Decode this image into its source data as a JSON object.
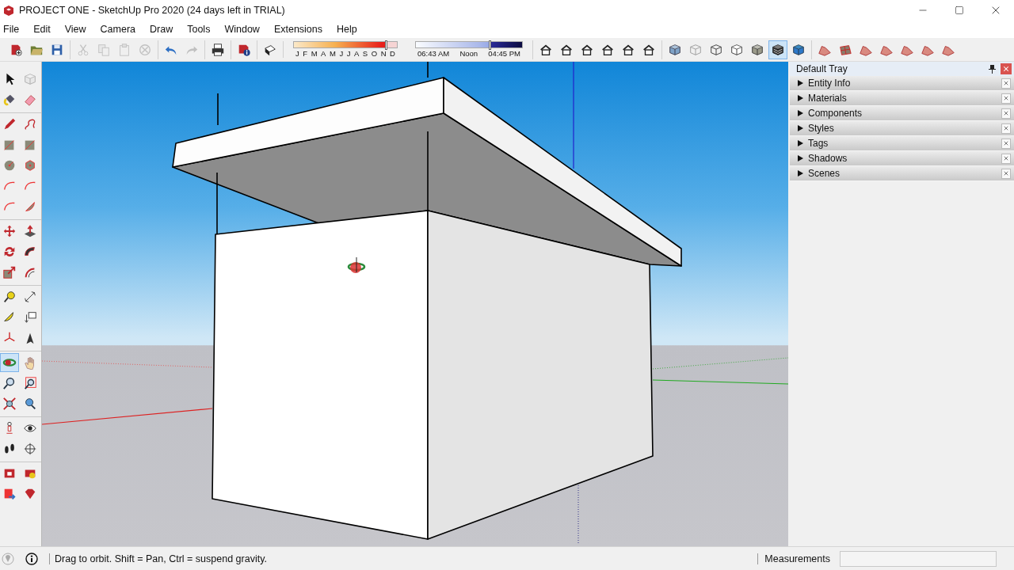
{
  "window": {
    "title": "PROJECT ONE - SketchUp Pro 2020 (24 days left in TRIAL)"
  },
  "menu": [
    "File",
    "Edit",
    "View",
    "Camera",
    "Draw",
    "Tools",
    "Window",
    "Extensions",
    "Help"
  ],
  "toolbar": [
    {
      "kind": "buttons",
      "items": [
        {
          "kind": "new",
          "disabled": false,
          "selected": false
        },
        {
          "kind": "open",
          "disabled": false,
          "selected": false
        },
        {
          "kind": "save",
          "disabled": false,
          "selected": false
        }
      ]
    },
    {
      "kind": "buttons",
      "items": [
        {
          "kind": "cut",
          "disabled": true,
          "selected": false
        },
        {
          "kind": "copy",
          "disabled": true,
          "selected": false
        },
        {
          "kind": "paste",
          "disabled": true,
          "selected": false
        },
        {
          "kind": "erase",
          "disabled": true,
          "selected": false
        }
      ]
    },
    {
      "kind": "buttons",
      "items": [
        {
          "kind": "undo",
          "disabled": false,
          "selected": false
        },
        {
          "kind": "redo",
          "disabled": true,
          "selected": false
        }
      ]
    },
    {
      "kind": "buttons",
      "items": [
        {
          "kind": "print",
          "disabled": false,
          "selected": false
        }
      ]
    },
    {
      "kind": "buttons",
      "items": [
        {
          "kind": "info",
          "disabled": false,
          "selected": false
        }
      ]
    },
    {
      "kind": "buttons",
      "items": [
        {
          "kind": "shadow",
          "disabled": false,
          "selected": false
        }
      ]
    },
    {
      "kind": "shadows",
      "months": [
        "J",
        "F",
        "M",
        "A",
        "M",
        "J",
        "J",
        "A",
        "S",
        "O",
        "N",
        "D"
      ],
      "date_slider": {
        "level": 0.9
      },
      "times": [
        "06:43 AM",
        "Noon",
        "04:45 PM"
      ],
      "time_slider": {
        "level": 0.7
      }
    },
    {
      "kind": "buttons",
      "items": [
        {
          "kind": "view",
          "disabled": false,
          "selected": false
        },
        {
          "kind": "view",
          "disabled": false,
          "selected": false
        },
        {
          "kind": "view",
          "disabled": false,
          "selected": false
        },
        {
          "kind": "view",
          "disabled": false,
          "selected": false
        },
        {
          "kind": "view",
          "disabled": false,
          "selected": false
        },
        {
          "kind": "view",
          "disabled": false,
          "selected": false
        }
      ]
    },
    {
      "kind": "buttons",
      "items": [
        {
          "kind": "xray",
          "disabled": false,
          "selected": false
        },
        {
          "kind": "backedges",
          "disabled": false,
          "selected": false
        },
        {
          "kind": "wireframe",
          "disabled": false,
          "selected": false
        },
        {
          "kind": "hidden",
          "disabled": false,
          "selected": false
        },
        {
          "kind": "shaded",
          "disabled": false,
          "selected": false
        },
        {
          "kind": "textured",
          "disabled": false,
          "selected": true
        },
        {
          "kind": "mono",
          "disabled": false,
          "selected": false
        }
      ]
    },
    {
      "kind": "buttons",
      "items": [
        {
          "kind": "terrain",
          "disabled": false,
          "selected": false
        },
        {
          "kind": "mesh",
          "disabled": false,
          "selected": false
        },
        {
          "kind": "terrain",
          "disabled": false,
          "selected": false
        },
        {
          "kind": "terrain",
          "disabled": false,
          "selected": false
        },
        {
          "kind": "terrain",
          "disabled": false,
          "selected": false
        },
        {
          "kind": "terrain",
          "disabled": false,
          "selected": false
        },
        {
          "kind": "terrain",
          "disabled": false,
          "selected": false
        }
      ]
    }
  ],
  "left_toolbar": [
    [
      {
        "kind": "select",
        "selected": false
      },
      {
        "kind": "component",
        "selected": false
      },
      {
        "kind": "paint",
        "selected": false
      },
      {
        "kind": "eraser",
        "selected": false
      }
    ],
    [
      {
        "kind": "pencil",
        "selected": false
      },
      {
        "kind": "freehand",
        "selected": false
      },
      {
        "kind": "rect",
        "selected": false
      },
      {
        "kind": "rect",
        "selected": false
      },
      {
        "kind": "circle",
        "selected": false
      },
      {
        "kind": "polygon",
        "selected": false
      },
      {
        "kind": "arc",
        "selected": false
      },
      {
        "kind": "arc",
        "selected": false
      },
      {
        "kind": "arc",
        "selected": false
      },
      {
        "kind": "pie",
        "selected": false
      }
    ],
    [
      {
        "kind": "move",
        "selected": false
      },
      {
        "kind": "pushpull",
        "selected": false
      },
      {
        "kind": "rotate",
        "selected": false
      },
      {
        "kind": "follow",
        "selected": false
      },
      {
        "kind": "scale",
        "selected": false
      },
      {
        "kind": "offset",
        "selected": false
      }
    ],
    [
      {
        "kind": "tape",
        "selected": false
      },
      {
        "kind": "dimension",
        "selected": false
      },
      {
        "kind": "protractor",
        "selected": false
      },
      {
        "kind": "textlabel",
        "selected": false
      },
      {
        "kind": "axes",
        "selected": false
      },
      {
        "kind": "text3d",
        "selected": false
      }
    ],
    [
      {
        "kind": "orbit",
        "selected": true
      },
      {
        "kind": "pan",
        "selected": false
      },
      {
        "kind": "zoom",
        "selected": false
      },
      {
        "kind": "zoomwin",
        "selected": false
      },
      {
        "kind": "extents",
        "selected": false
      },
      {
        "kind": "previous",
        "selected": false
      }
    ],
    [
      {
        "kind": "position",
        "selected": false
      },
      {
        "kind": "look",
        "selected": false
      },
      {
        "kind": "walk",
        "selected": false
      },
      {
        "kind": "section",
        "selected": false
      }
    ],
    [
      {
        "kind": "warehouse",
        "selected": false
      },
      {
        "kind": "extension",
        "selected": false
      },
      {
        "kind": "share",
        "selected": false
      },
      {
        "kind": "ruby",
        "selected": false
      }
    ]
  ],
  "tray": {
    "title": "Default Tray",
    "panels": [
      {
        "label": "Entity Info",
        "expanded": false
      },
      {
        "label": "Materials",
        "expanded": false
      },
      {
        "label": "Components",
        "expanded": false
      },
      {
        "label": "Styles",
        "expanded": false
      },
      {
        "label": "Tags",
        "expanded": false
      },
      {
        "label": "Shadows",
        "expanded": false
      },
      {
        "label": "Scenes",
        "expanded": false
      }
    ]
  },
  "status_bar": {
    "message": "Drag to orbit. Shift = Pan, Ctrl = suspend gravity.",
    "measurements_label": "Measurements"
  }
}
